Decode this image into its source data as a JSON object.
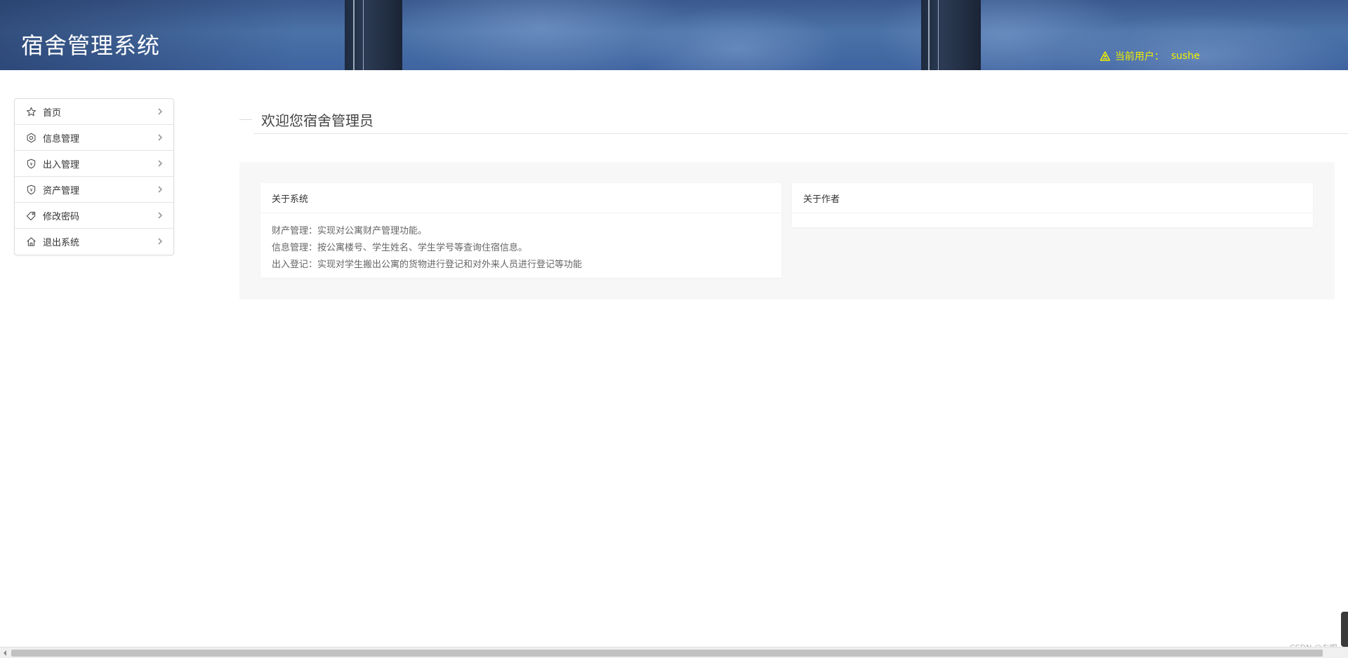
{
  "header": {
    "app_title": "宿舍管理系统",
    "user_label": "当前用户：",
    "user_name": "sushe",
    "user_color": "#f2f000",
    "user_icon": "warning-user-icon"
  },
  "sidebar": {
    "items": [
      {
        "label": "首页",
        "icon": "star-icon"
      },
      {
        "label": "信息管理",
        "icon": "gear-icon"
      },
      {
        "label": "出入管理",
        "icon": "shield-icon"
      },
      {
        "label": "资产管理",
        "icon": "shield-icon"
      },
      {
        "label": "修改密码",
        "icon": "tag-icon"
      },
      {
        "label": "退出系统",
        "icon": "home-icon"
      }
    ],
    "chevron_icon": "chevron-right-icon"
  },
  "main": {
    "welcome": "欢迎您宿舍管理员",
    "cards": {
      "about_system": {
        "title": "关于系统",
        "lines": [
          "财产管理：实现对公寓财产管理功能。",
          "信息管理：按公寓楼号、学生姓名、学生学号等查询住宿信息。",
          "出入登记：实现对学生搬出公寓的货物进行登记和对外来人员进行登记等功能"
        ]
      },
      "about_author": {
        "title": "关于作者"
      }
    }
  },
  "footer": {
    "watermark": "CSDN @左眼"
  }
}
